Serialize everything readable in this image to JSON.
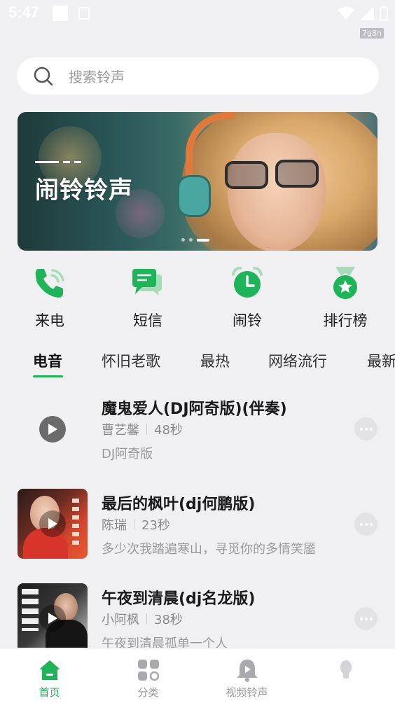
{
  "status_bar": {
    "time": "5:47",
    "device_id": "7g8n"
  },
  "search": {
    "placeholder": "搜索铃声"
  },
  "banner": {
    "title": "闹铃铃声"
  },
  "quick_actions": [
    {
      "label": "来电",
      "icon": "phone-icon"
    },
    {
      "label": "短信",
      "icon": "message-icon"
    },
    {
      "label": "闹铃",
      "icon": "alarm-clock-icon"
    },
    {
      "label": "排行榜",
      "icon": "medal-icon"
    }
  ],
  "tabs": [
    "电音",
    "怀旧老歌",
    "最热",
    "网络流行",
    "最新"
  ],
  "active_tab": "电音",
  "songs": [
    {
      "title": "魔鬼爱人(DJ阿奇版)(伴奏)",
      "artist": "曹艺馨",
      "duration": "48秒",
      "desc": "DJ阿奇版"
    },
    {
      "title": "最后的枫叶(dj何鹏版)",
      "artist": "陈瑞",
      "duration": "23秒",
      "desc": "多少次我踏遍寒山，寻觅你的多情笑靥"
    },
    {
      "title": "午夜到清晨(dj名龙版)",
      "artist": "小阿枫",
      "duration": "38秒",
      "desc": "午夜到清晨孤单一个人"
    }
  ],
  "bottom_nav": [
    {
      "label": "首页",
      "icon": "home-icon",
      "active": true
    },
    {
      "label": "分类",
      "icon": "category-icon",
      "active": false
    },
    {
      "label": "视频铃声",
      "icon": "video-ringtone-icon",
      "active": false
    },
    {
      "label": "",
      "icon": "profile-icon",
      "active": false
    }
  ],
  "colors": {
    "accent": "#1fb45a",
    "background": "#f0f0f3"
  }
}
